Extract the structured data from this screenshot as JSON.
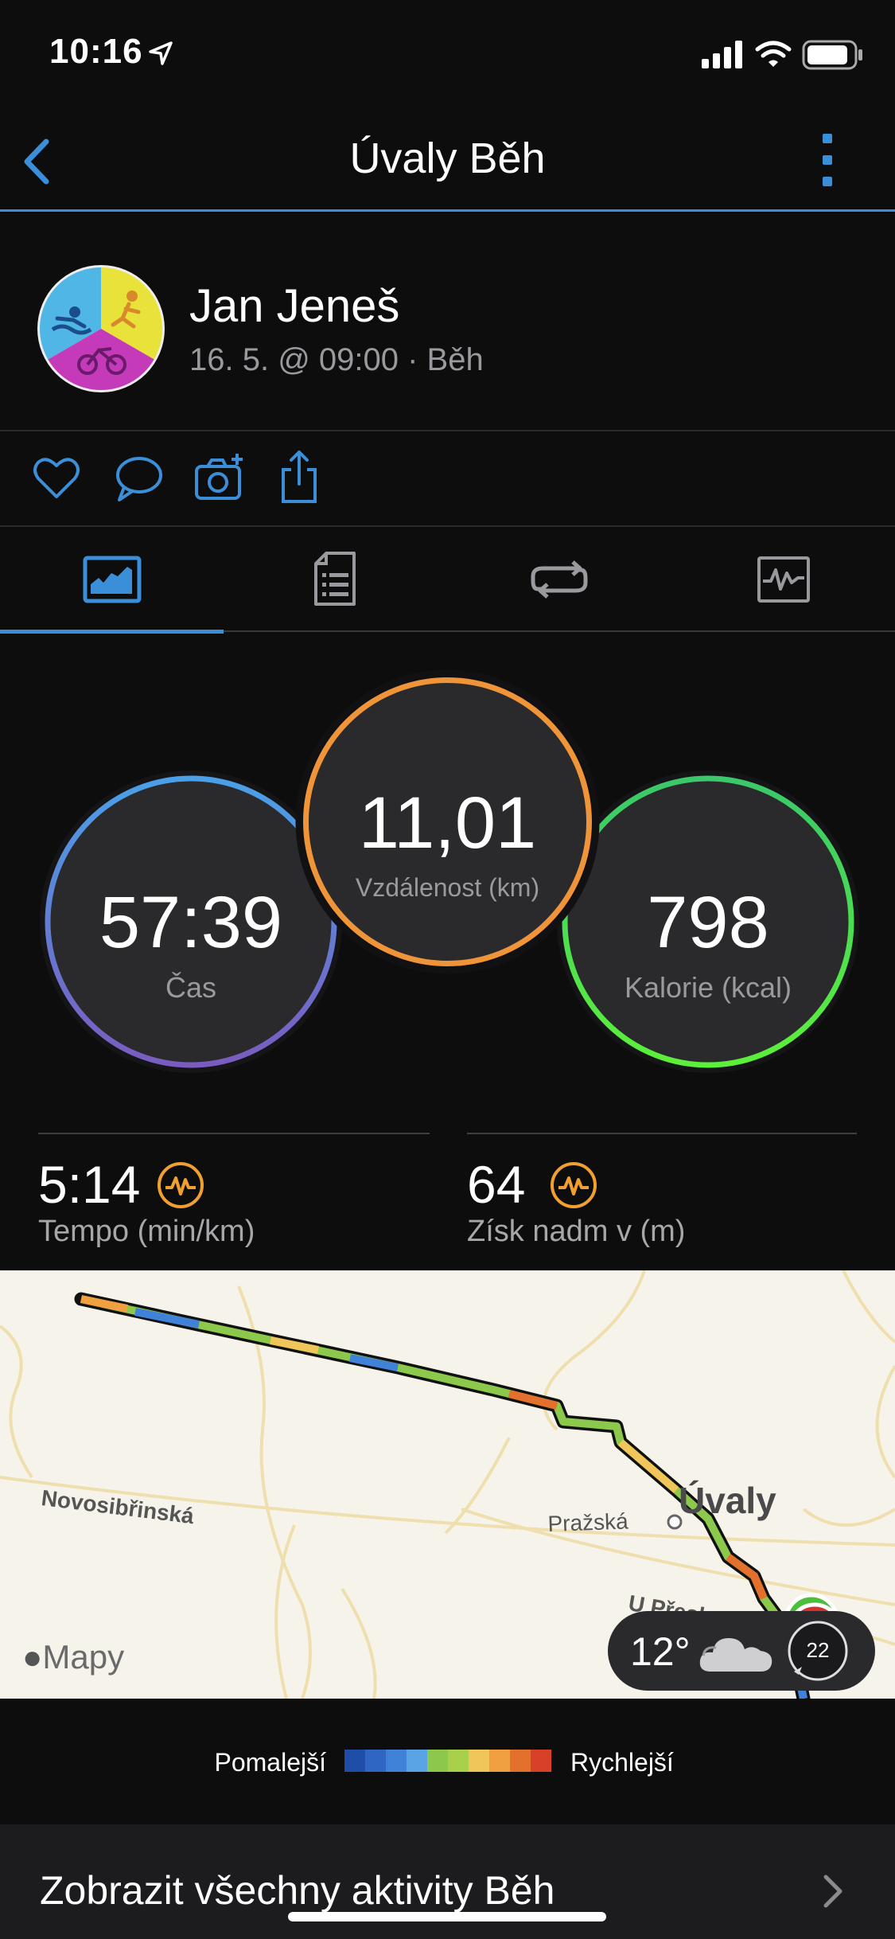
{
  "status_bar": {
    "time": "10:16"
  },
  "nav": {
    "title": "Úvaly Běh"
  },
  "profile": {
    "name": "Jan Jeneš",
    "subtitle": "16. 5. @ 09:00 · Běh"
  },
  "circles": {
    "time": {
      "value": "57:39",
      "label": "Čas",
      "color": "#5b8fd6"
    },
    "distance": {
      "value": "11,01",
      "label": "Vzdálenost (km)",
      "color": "#f0943a"
    },
    "calories": {
      "value": "798",
      "label": "Kalorie (kcal)",
      "color": "#4fe06a"
    }
  },
  "stats": [
    {
      "value": "5:14",
      "label": "Tempo (min/km)"
    },
    {
      "value": "64",
      "label": "Získ nadm v (m)"
    }
  ],
  "map": {
    "labels": {
      "town": "Úvaly",
      "street1": "Novosibřinská",
      "street2": "Pražská",
      "street3": "U Přeslo…"
    },
    "provider": "Mapy",
    "weather": {
      "temp": "12°",
      "wind": "22"
    }
  },
  "legend": {
    "slower": "Pomalejší",
    "faster": "Rychlejší",
    "colors": [
      "#1f4ea8",
      "#2f66c4",
      "#3f82d8",
      "#5aa4e6",
      "#8cc84b",
      "#a9d04a",
      "#f0c65a",
      "#f0a040",
      "#e4702e",
      "#d8402a"
    ]
  },
  "footer": {
    "label": "Zobrazit všechny aktivity Běh"
  }
}
